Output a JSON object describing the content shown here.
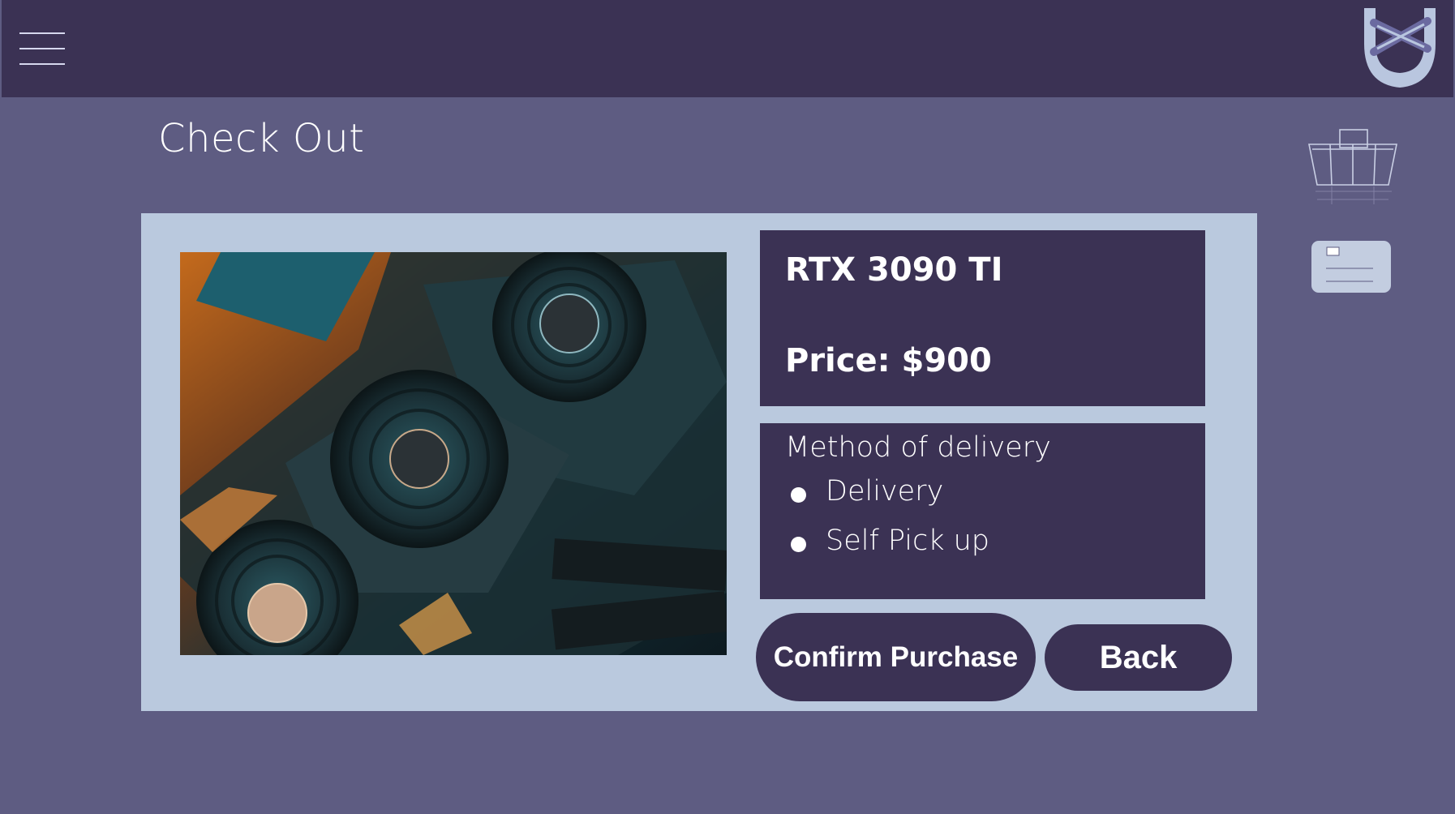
{
  "header": {
    "menu_icon": "hamburger-menu-icon",
    "logo_icon": "shield-x-logo"
  },
  "page": {
    "title": "Check Out"
  },
  "side_icons": {
    "cart_icon": "shopping-basket-icon",
    "card_icon": "payment-card-icon"
  },
  "product": {
    "image_desc_icon": "gpu-photo",
    "name": "RTX 3090 TI",
    "price": "Price: $900"
  },
  "delivery": {
    "title": "Method of delivery",
    "options": [
      {
        "label": "Delivery"
      },
      {
        "label": "Self Pick up"
      }
    ]
  },
  "buttons": {
    "confirm": "Confirm Purchase",
    "back": "Back"
  },
  "colors": {
    "background": "#5e5c82",
    "header": "#3b3254",
    "panel": "#bac9de",
    "box": "#3b3254",
    "text": "#ffffff"
  }
}
